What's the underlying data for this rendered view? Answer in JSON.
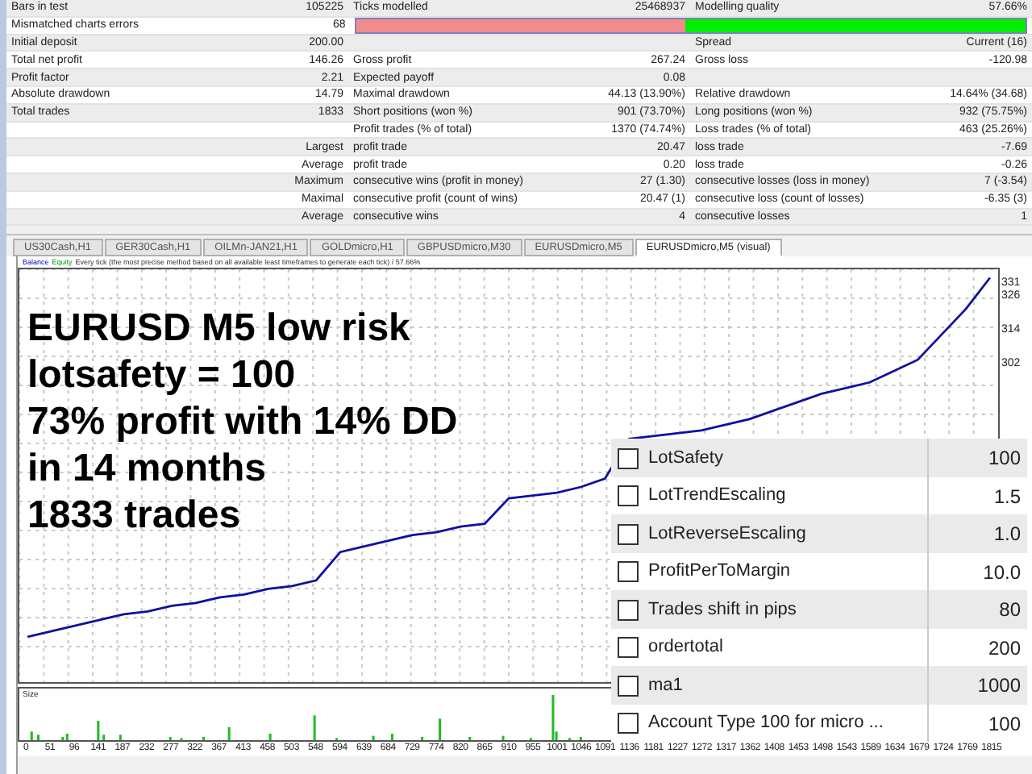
{
  "stats": {
    "rows": [
      {
        "kind": "cells",
        "cells": [
          {
            "label": "Bars in test",
            "value": "105225"
          },
          {
            "label": "Ticks modelled",
            "value": "25468937"
          },
          {
            "label": "Modelling quality",
            "value": "57.66%"
          }
        ]
      },
      {
        "kind": "bar",
        "cells": [
          {
            "label": "Mismatched charts errors",
            "value": "68"
          }
        ],
        "quality_bar": {
          "level": 0.51
        }
      },
      {
        "kind": "cells",
        "cells": [
          {
            "label": "Initial deposit",
            "value": "200.00"
          },
          {},
          {
            "label": "Spread",
            "value": "Current (16)"
          }
        ]
      },
      {
        "kind": "cells",
        "cells": [
          {
            "label": "Total net profit",
            "value": "146.26"
          },
          {
            "label": "Gross profit",
            "value": "267.24"
          },
          {
            "label": "Gross loss",
            "value": "-120.98"
          }
        ]
      },
      {
        "kind": "cells",
        "cells": [
          {
            "label": "Profit factor",
            "value": "2.21"
          },
          {
            "label": "Expected payoff",
            "value": "0.08"
          },
          {}
        ]
      },
      {
        "kind": "cells",
        "cells": [
          {
            "label": "Absolute drawdown",
            "value": "14.79"
          },
          {
            "label": "Maximal drawdown",
            "value": "44.13 (13.90%)"
          },
          {
            "label": "Relative drawdown",
            "value": "14.64% (34.68)"
          }
        ]
      },
      {
        "kind": "cells",
        "cells": [
          {
            "label": "Total trades",
            "value": "1833"
          },
          {
            "label": "Short positions (won %)",
            "value": "901 (73.70%)"
          },
          {
            "label": "Long positions (won %)",
            "value": "932 (75.75%)"
          }
        ]
      },
      {
        "kind": "cells",
        "cells": [
          {},
          {
            "label": "Profit trades (% of total)",
            "value": "1370 (74.74%)"
          },
          {
            "label": "Loss trades (% of total)",
            "value": "463 (25.26%)"
          }
        ]
      },
      {
        "kind": "cells",
        "cells": [
          {
            "value": "Largest"
          },
          {
            "label": "profit trade",
            "value": "20.47"
          },
          {
            "label": "loss trade",
            "value": "-7.69"
          }
        ]
      },
      {
        "kind": "cells",
        "cells": [
          {
            "value": "Average"
          },
          {
            "label": "profit trade",
            "value": "0.20"
          },
          {
            "label": "loss trade",
            "value": "-0.26"
          }
        ]
      },
      {
        "kind": "cells",
        "cells": [
          {
            "value": "Maximum"
          },
          {
            "label": "consecutive wins (profit in money)",
            "value": "27 (1.30)"
          },
          {
            "label": "consecutive losses (loss in money)",
            "value": "7 (-3.54)"
          }
        ]
      },
      {
        "kind": "cells",
        "cells": [
          {
            "value": "Maximal"
          },
          {
            "label": "consecutive profit (count of wins)",
            "value": "20.47 (1)"
          },
          {
            "label": "consecutive loss (count of losses)",
            "value": "-6.35 (3)"
          }
        ]
      },
      {
        "kind": "cells",
        "cells": [
          {
            "value": "Average"
          },
          {
            "label": "consecutive wins",
            "value": "4"
          },
          {
            "label": "consecutive losses",
            "value": "1"
          }
        ]
      }
    ]
  },
  "tabs": [
    {
      "label": "US30Cash,H1",
      "selected": false
    },
    {
      "label": "GER30Cash,H1",
      "selected": false
    },
    {
      "label": "OILMn-JAN21,H1",
      "selected": false
    },
    {
      "label": "GOLDmicro,H1",
      "selected": false
    },
    {
      "label": "GBPUSDmicro,M30",
      "selected": false
    },
    {
      "label": "EURUSDmicro,M5",
      "selected": false
    },
    {
      "label": "EURUSDmicro,M5 (visual)",
      "selected": true
    }
  ],
  "chart": {
    "legend": [
      "Equity",
      "Every tick (the most precise method based on all available least timeframes to generate each tick) / 57.66%"
    ],
    "chart_data": {
      "type": "line",
      "grid": true,
      "ylim": [
        190,
        336
      ],
      "yticks": [
        {
          "value": 331,
          "label": "331"
        },
        {
          "value": 326,
          "label": "326"
        },
        {
          "value": 314,
          "label": "314"
        },
        {
          "value": 302,
          "label": "302"
        }
      ],
      "categories": [
        "0",
        "51",
        "96",
        "141",
        "187",
        "232",
        "277",
        "322",
        "367",
        "413",
        "458",
        "503",
        "548",
        "594",
        "639",
        "684",
        "729",
        "774",
        "820",
        "865",
        "910",
        "955",
        "1001",
        "1046",
        "1091",
        "1136",
        "1181",
        "1227",
        "1272",
        "1317",
        "1362",
        "1408",
        "1453",
        "1498",
        "1543",
        "1589",
        "1634",
        "1679",
        "1724",
        "1769",
        "1815"
      ],
      "series": [
        {
          "name": "Balance",
          "color": "#1010a0",
          "values": [
            206,
            208,
            210,
            212,
            214,
            215,
            217,
            218,
            220,
            221,
            223,
            224,
            226,
            236,
            238,
            240,
            242,
            243,
            245,
            246,
            255,
            256,
            257,
            259,
            262,
            276,
            277,
            278,
            279,
            281,
            283,
            286,
            289,
            292,
            294,
            296,
            300,
            304,
            313,
            322,
            333
          ]
        }
      ]
    },
    "size_label": "Size"
  },
  "overlay_lines": [
    "EURUSD M5 low risk",
    "lotsafety = 100",
    "73% profit with 14% DD",
    "in 14 months",
    "1833 trades"
  ],
  "parameters": [
    {
      "name": "LotSafety",
      "value": "100",
      "checked": false
    },
    {
      "name": "LotTrendEscaling",
      "value": "1.5",
      "checked": false
    },
    {
      "name": "LotReverseEscaling",
      "value": "1.0",
      "checked": false
    },
    {
      "name": "ProfitPerToMargin",
      "value": "10.0",
      "checked": false
    },
    {
      "name": "Trades shift in pips",
      "value": "80",
      "checked": false
    },
    {
      "name": "ordertotal",
      "value": "200",
      "checked": false
    },
    {
      "name": "ma1",
      "value": "1000",
      "checked": false
    },
    {
      "name": "Account Type 100 for micro ...",
      "value": "100",
      "checked": false
    }
  ]
}
